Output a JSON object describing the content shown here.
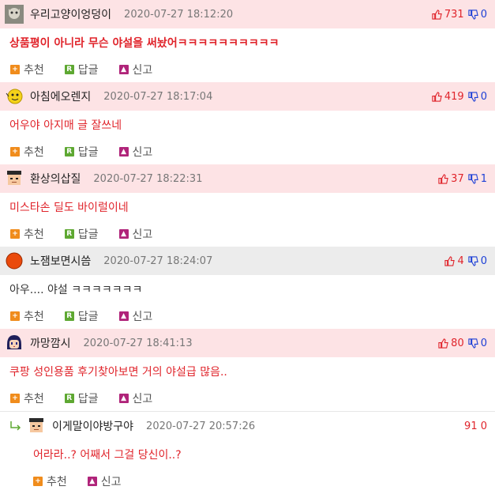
{
  "labels": {
    "recommend": "추천",
    "reply": "답글",
    "report": "신고"
  },
  "comments": [
    {
      "nick": "우리고양이엉덩이",
      "date": "2020-07-27 18:12:20",
      "up": "731",
      "down": "0",
      "text": "상품평이 아니라 무슨 야설을 써놨어ㅋㅋㅋㅋㅋㅋㅋㅋㅋㅋ",
      "avatar": "cat-photo-avatar"
    },
    {
      "nick": "아침에오렌지",
      "date": "2020-07-27 18:17:04",
      "up": "419",
      "down": "0",
      "text": "어우야 아지매 글 잘쓰네",
      "avatar": "yellow-character-avatar"
    },
    {
      "nick": "환상의삽질",
      "date": "2020-07-27 18:22:31",
      "up": "37",
      "down": "1",
      "text": "미스타손 딜도 바이럴이네",
      "avatar": "graduate-cap-avatar"
    },
    {
      "nick": "노잼보면시씀",
      "date": "2020-07-27 18:24:07",
      "up": "4",
      "down": "0",
      "text": "아우.... 야설 ㅋㅋㅋㅋㅋㅋㅋ",
      "avatar": "orange-circle-avatar"
    },
    {
      "nick": "까망깜시",
      "date": "2020-07-27 18:41:13",
      "up": "80",
      "down": "0",
      "text": "쿠팡 성인용품 후기찾아보면 거의 야설급 많음..",
      "avatar": "dark-hair-girl-avatar"
    }
  ],
  "reply_comment": {
    "nick": "이게말이야방구야",
    "date": "2020-07-27 20:57:26",
    "count": "91 0",
    "text": "어라라..? 어째서 그걸 당신이..?",
    "avatar": "graduate-cap-avatar"
  }
}
